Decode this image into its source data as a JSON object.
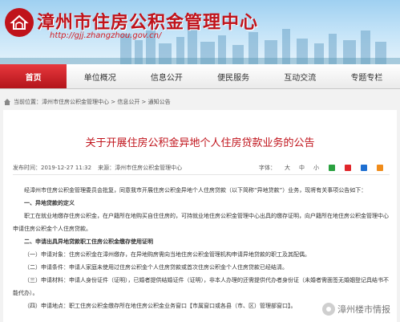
{
  "header": {
    "site_title": "漳州市住房公积金管理中心",
    "site_url": "http://gjj.zhangzhou.gov.cn/"
  },
  "nav": [
    {
      "label": "首页"
    },
    {
      "label": "单位概况"
    },
    {
      "label": "信息公开"
    },
    {
      "label": "便民服务"
    },
    {
      "label": "互动交流"
    },
    {
      "label": "专题专栏"
    }
  ],
  "breadcrumb": "当前位置：漳州市住房公积金管理中心 > 信息公开 > 通知公告",
  "article": {
    "title": "关于开展住房公积金异地个人住房贷款业务的公告",
    "date": "发布时间：2019-12-27 11:32",
    "source": "来源：漳州市住房公积金管理中心",
    "font_label": "字体：",
    "size_large": "大",
    "size_mid": "中",
    "size_small": "小",
    "paragraphs": [
      {
        "text": "经漳州市住房公积金管理委员会批复，同意我市开展住房公积金异地个人住房贷款（以下简称“异地贷款”）业务，现将有关事项公告如下：",
        "heading": false
      },
      {
        "text": "一、异地贷款的定义",
        "heading": true
      },
      {
        "text": "职工在就业地缴存住房公积金，在户籍所在地购买自住住房的，可持就业地住房公积金管理中心出具的缴存证明，向户籍所在地住房公积金管理中心申请住房公积金个人住房贷款。",
        "heading": false
      },
      {
        "text": "二、申请出具异地贷款职工住房公积金缴存使用证明",
        "heading": true
      },
      {
        "text": "（一）申请对象：住房公积金在漳州缴存，在异地购房需向当地住房公积金管理机构申请异地贷款的职工及其配偶。",
        "heading": false
      },
      {
        "text": "（二）申请条件：申请人家庭未使用过住房公积金个人住房贷款或首次住房公积金个人住房贷款已经结清。",
        "heading": false
      },
      {
        "text": "（三）申请材料：申请人身份证件（证明），已婚者提供结婚证件（证明），非本人办理的还需提供代办者身份证（未婚者需面签无婚姻登记具结书不能代办）。",
        "heading": false
      },
      {
        "text": "（四）申请地点：职工住房公积金缴存所在地住房公积金业务窗口【市属窗口或各县（市、区）管理部窗口】。",
        "heading": false
      }
    ]
  },
  "watermark": "漳州楼市情报"
}
